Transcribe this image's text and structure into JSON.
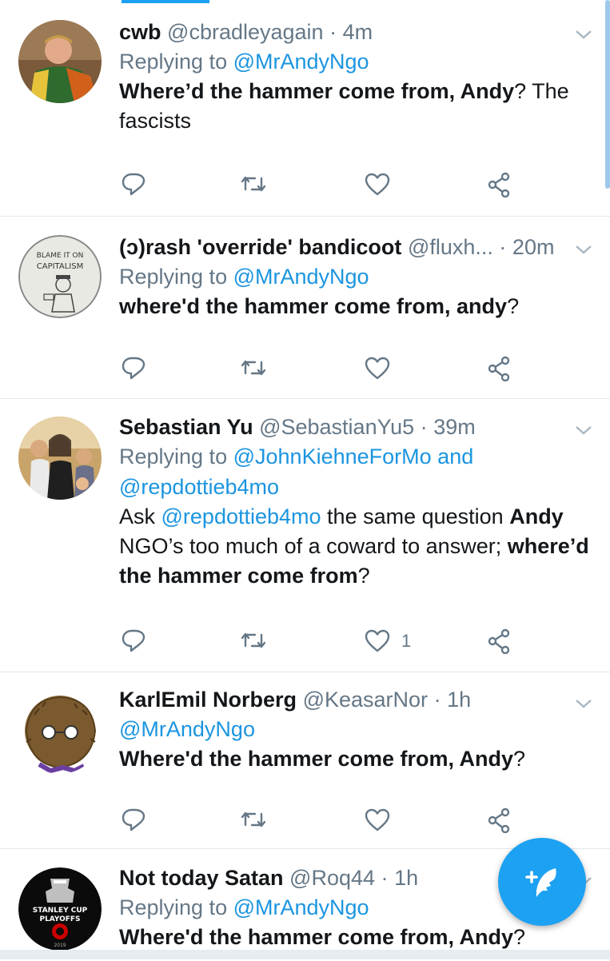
{
  "tweets": [
    {
      "name": "cwb",
      "handle": "@cbradleyagain",
      "time": "4m",
      "replying_prefix": "Replying to",
      "replying_to": "@MrAndyNgo",
      "replying_joiner": "",
      "replying_to2": "",
      "body": [
        {
          "t": "Where’d the hammer come from, Andy",
          "s": "b"
        },
        {
          "t": "? The fascists",
          "s": "n"
        }
      ],
      "likes": ""
    },
    {
      "name": "(ɔ)rash 'override' bandicoot",
      "handle": "@fluxh...",
      "time": "20m",
      "replying_prefix": "Replying to",
      "replying_to": "@MrAndyNgo",
      "replying_joiner": "",
      "replying_to2": "",
      "body": [
        {
          "t": "where'd the hammer come from, andy",
          "s": "b"
        },
        {
          "t": "?",
          "s": "n"
        }
      ],
      "likes": ""
    },
    {
      "name": "Sebastian Yu",
      "handle": "@SebastianYu5",
      "time": "39m",
      "replying_prefix": "Replying to",
      "replying_to": "@JohnKiehneForMo",
      "replying_joiner": "and",
      "replying_to2": "@repdottieb4mo",
      "body": [
        {
          "t": "Ask ",
          "s": "n"
        },
        {
          "t": "@repdottieb4mo",
          "s": "m"
        },
        {
          "t": " the same question ",
          "s": "n"
        },
        {
          "t": "Andy",
          "s": "b"
        },
        {
          "t": " NGO’s too much of a coward to answer; ",
          "s": "n"
        },
        {
          "t": "where’d the hammer come from",
          "s": "b"
        },
        {
          "t": "?",
          "s": "n"
        }
      ],
      "likes": "1"
    },
    {
      "name": "KarlEmil Norberg",
      "handle": "@KeasarNor",
      "time": "1h",
      "replying_prefix": "",
      "replying_to": "@MrAndyNgo",
      "replying_joiner": "",
      "replying_to2": "",
      "body": [
        {
          "t": "Where'd the hammer come from, Andy",
          "s": "b"
        },
        {
          "t": "?",
          "s": "n"
        }
      ],
      "likes": ""
    },
    {
      "name": "Not today Satan",
      "handle": "@Roq44",
      "time": "1h",
      "replying_prefix": "Replying to",
      "replying_to": "@MrAndyNgo",
      "replying_joiner": "",
      "replying_to2": "",
      "body": [
        {
          "t": "Where'd the hammer come from, Andy",
          "s": "b"
        },
        {
          "t": "?",
          "s": "n"
        }
      ],
      "likes": ""
    }
  ],
  "avatar_texts": {
    "bandicoot": "BLAME IT ON CAPITALISM",
    "satan_top": "STANLEY CUP",
    "satan_bottom": "PLAYOFFS",
    "satan_year": "2019"
  },
  "icons": {
    "reply": "reply-icon",
    "retweet": "retweet-icon",
    "like": "heart-icon",
    "share": "share-icon",
    "caret": "chevron-down-icon",
    "compose": "compose-tweet-icon"
  },
  "colors": {
    "accent": "#1da1f2",
    "link": "#1b95e0",
    "muted": "#657786",
    "divider": "#e1e8ed"
  }
}
